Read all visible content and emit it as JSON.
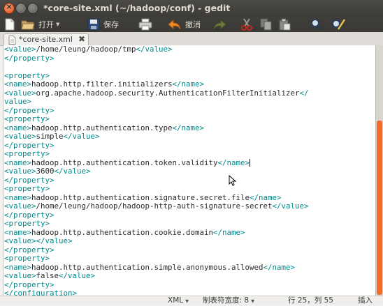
{
  "window": {
    "title": "*core-site.xml (~/hadoop/conf) - gedit"
  },
  "toolbar": {
    "items": [
      {
        "id": "new",
        "icon": "new-document-icon",
        "label": ""
      },
      {
        "id": "open",
        "icon": "open-folder-icon",
        "label": "打开"
      },
      {
        "id": "save",
        "icon": "save-icon",
        "label": "保存"
      },
      {
        "id": "print",
        "icon": "printer-icon",
        "label": ""
      },
      {
        "id": "undo",
        "icon": "undo-icon",
        "label": "撤消"
      },
      {
        "id": "redo",
        "icon": "redo-icon",
        "label": ""
      },
      {
        "id": "cut",
        "icon": "scissors-icon",
        "label": ""
      },
      {
        "id": "copy",
        "icon": "copy-icon",
        "label": ""
      },
      {
        "id": "paste",
        "icon": "paste-icon",
        "label": ""
      },
      {
        "id": "find",
        "icon": "magnifier-icon",
        "label": ""
      },
      {
        "id": "replace",
        "icon": "find-replace-icon",
        "label": ""
      }
    ]
  },
  "tab": {
    "label": "*core-site.xml"
  },
  "editor": {
    "lines": [
      [
        "<value>",
        "/home/leung/hadoop/tmp",
        "</value>"
      ],
      [
        "</property>"
      ],
      [
        ""
      ],
      [
        "<property>"
      ],
      [
        "<name>",
        "hadoop.http.filter.initializers",
        "</name>"
      ],
      [
        "<value>",
        "org.apache.hadoop.security.AuthenticationFilterInitializer",
        "</"
      ],
      [
        "value>"
      ],
      [
        "</property>"
      ],
      [
        "<property>"
      ],
      [
        "<name>",
        "hadoop.http.authentication.type",
        "</name>"
      ],
      [
        "<value>",
        "simple",
        "</value>"
      ],
      [
        "</property>"
      ],
      [
        "<property>"
      ],
      [
        "<name>",
        "hadoop.http.authentication.token.validity",
        "</name>"
      ],
      [
        "<value>",
        "3600",
        "</value>"
      ],
      [
        "</property>"
      ],
      [
        "<property>"
      ],
      [
        "<name>",
        "hadoop.http.authentication.signature.secret.file",
        "</name>"
      ],
      [
        "<value>",
        "/home/leung/hadoop/hadoop-http-auth-signature-secret",
        "</value>"
      ],
      [
        "</property>"
      ],
      [
        "<property>"
      ],
      [
        "<name>",
        "hadoop.http.authentication.cookie.domain",
        "</name>"
      ],
      [
        "<value>",
        "",
        "</value>"
      ],
      [
        "</property>"
      ],
      [
        "<property>"
      ],
      [
        "<name>",
        "hadoop.http.authentication.simple.anonymous.allowed",
        "</name>"
      ],
      [
        "<value>",
        "false",
        "</value>"
      ],
      [
        "</property>"
      ],
      [
        "</configuration>"
      ]
    ],
    "colors": {
      "tag": "#008a8c",
      "text": "#2a2a2a",
      "scroll_thumb": "#f26a2c"
    }
  },
  "statusbar": {
    "language": "XML",
    "tab_width": "制表符宽度: 8",
    "position": "行 25，列 55",
    "mode": "插入"
  }
}
